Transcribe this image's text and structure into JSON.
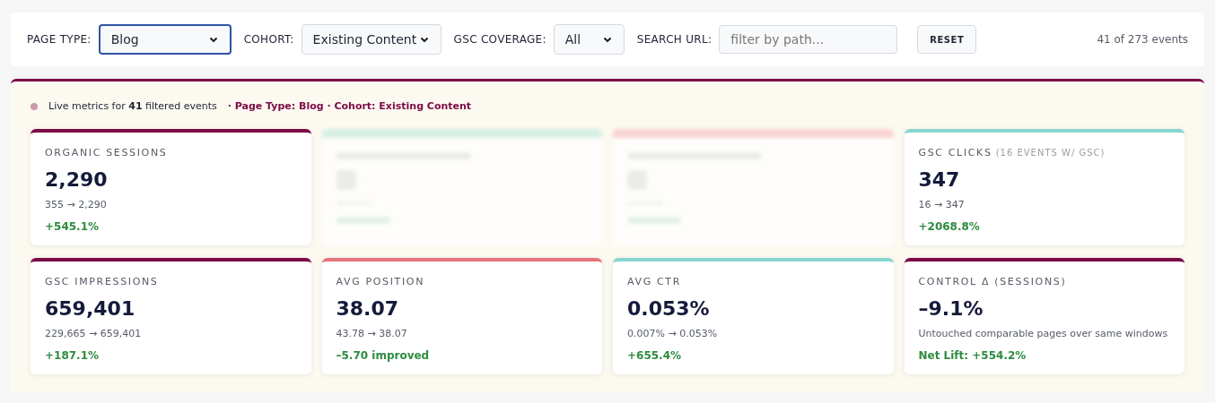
{
  "filters": [
    {
      "kind": "select",
      "label": "PAGE TYPE:",
      "value": "Blog",
      "focused": true
    },
    {
      "kind": "select",
      "label": "COHORT:",
      "value": "Existing Content",
      "focused": false
    },
    {
      "kind": "select",
      "label": "GSC COVERAGE:",
      "value": "All",
      "focused": false
    },
    {
      "kind": "input",
      "label": "SEARCH URL:",
      "placeholder": "filter by path..."
    }
  ],
  "reset_button": "RESET",
  "event_count": "41 of 273 events",
  "live_bar": {
    "prefix": "Live metrics for **41** filtered events",
    "context": "· Page Type: Blog · Cohort: Existing Content"
  },
  "cards": [
    {
      "kind": "metric",
      "color": "#7b0a45",
      "title": "ORGANIC SESSIONS",
      "value": "2,290",
      "detail": "355 → 2,290",
      "change": "+545.1%"
    },
    {
      "kind": "blurred",
      "color": "#d4efe2"
    },
    {
      "kind": "blurred",
      "color": "#f8d3d3"
    },
    {
      "kind": "metric",
      "color": "#86d6cf",
      "title": "GSC CLICKS",
      "note": "(16 EVENTS W/ GSC)",
      "value": "347",
      "detail": "16 → 347",
      "change": "+2068.8%"
    },
    {
      "kind": "metric",
      "color": "#7b0a45",
      "title": "GSC IMPRESSIONS",
      "value": "659,401",
      "detail": "229,665 → 659,401",
      "change": "+187.1%"
    },
    {
      "kind": "metric",
      "color": "#e8747c",
      "title": "AVG POSITION",
      "value": "38.07",
      "detail": "43.78 → 38.07",
      "change": "–5.70 improved"
    },
    {
      "kind": "metric",
      "color": "#86d6cf",
      "title": "AVG CTR",
      "value": "0.053%",
      "detail": "0.007% → 0.053%",
      "change": "+655.4%"
    },
    {
      "kind": "metric",
      "color": "#7b0a45",
      "title": "CONTROL Δ (SESSIONS)",
      "value": "–9.1%",
      "detail": "Untouched comparable pages over same windows",
      "change": "Net Lift: +554.2%"
    }
  ]
}
